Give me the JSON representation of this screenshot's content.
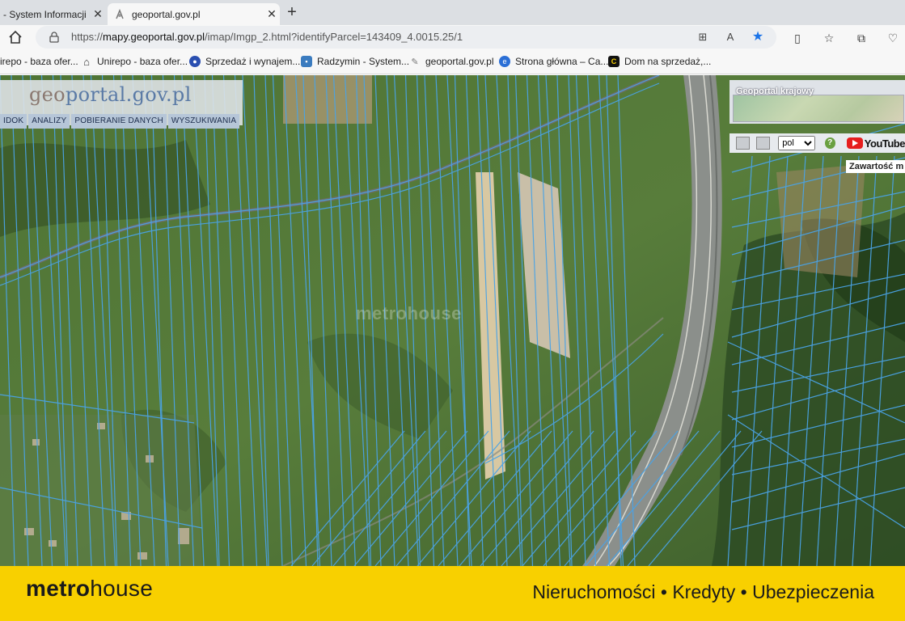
{
  "browser": {
    "tabs": [
      {
        "title": "- System Informacji Pr",
        "active": false
      },
      {
        "title": "geoportal.gov.pl",
        "active": true
      }
    ],
    "new_tab_label": "+",
    "close_glyph": "✕",
    "address": {
      "url_prefix": "https://",
      "url_host": "mapy.geoportal.gov.pl",
      "url_path": "/imap/Imgp_2.html?identifyParcel=143409_4.0015.25/1"
    },
    "bookmarks": [
      {
        "label": "irepo - baza ofer...",
        "icon": "none"
      },
      {
        "label": "Unirepo - baza ofer...",
        "icon": "house-icon"
      },
      {
        "label": "Sprzedaż i wynajem...",
        "icon": "globe-icon",
        "color": "#2a4fb0"
      },
      {
        "label": "Radzymin - System...",
        "icon": "app-icon",
        "color": "#3a7bbf"
      },
      {
        "label": "geoportal.gov.pl",
        "icon": "geoportal-icon"
      },
      {
        "label": "Strona główna – Ca...",
        "icon": "edge-icon",
        "color": "#2b6fd6"
      },
      {
        "label": "Dom na sprzedaż,...",
        "icon": "c-logo-icon",
        "color": "#111111"
      }
    ]
  },
  "geoportal": {
    "logo_geo": "geo",
    "logo_rest": "portal.gov.pl",
    "nav": [
      "IDOK",
      "ANALIZY",
      "POBIERANIE DANYCH",
      "WYSZUKIWANIA"
    ],
    "overview_title": "Geoportal krajowy",
    "language": "pol",
    "youtube_label": "YouTube",
    "content_label": "Zawartość m"
  },
  "watermark": "metrohouse",
  "footer": {
    "brand_metro": "metro",
    "brand_house": "house",
    "tagline": "Nieruchomości • Kredyty • Ubezpieczenia",
    "background": "#f8d000"
  },
  "colors": {
    "accent_star": "#1a73e8",
    "parcel_lines": "#4aa3e6"
  }
}
